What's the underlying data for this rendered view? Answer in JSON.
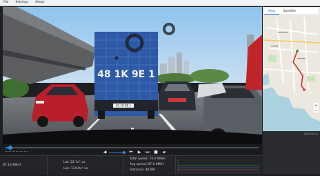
{
  "app": {
    "menu": [
      "File",
      "Settings",
      "About"
    ]
  },
  "video": {
    "plate": "48 1K 9E 1",
    "plate_small": "01 1K 9E 1"
  },
  "map": {
    "tabs": [
      "Map",
      "Satellite"
    ],
    "active_tab": 0,
    "status": "2020-05-01"
  },
  "playback": {
    "progress": 0.02,
    "volume": 0.75
  },
  "info": {
    "speed": "87.14 KM/H",
    "lat": "Lat: 22.7x°.xx",
    "lng": "Lon: 114.0x°.xx",
    "mileage": "Total speed: 75.0 KM/H",
    "avg_speed": "Avg speed: 87.0 KM/H",
    "distance": "Distance: 48 KM"
  },
  "colors": {
    "accent": "#2f8ce6",
    "route": "#d93025"
  }
}
